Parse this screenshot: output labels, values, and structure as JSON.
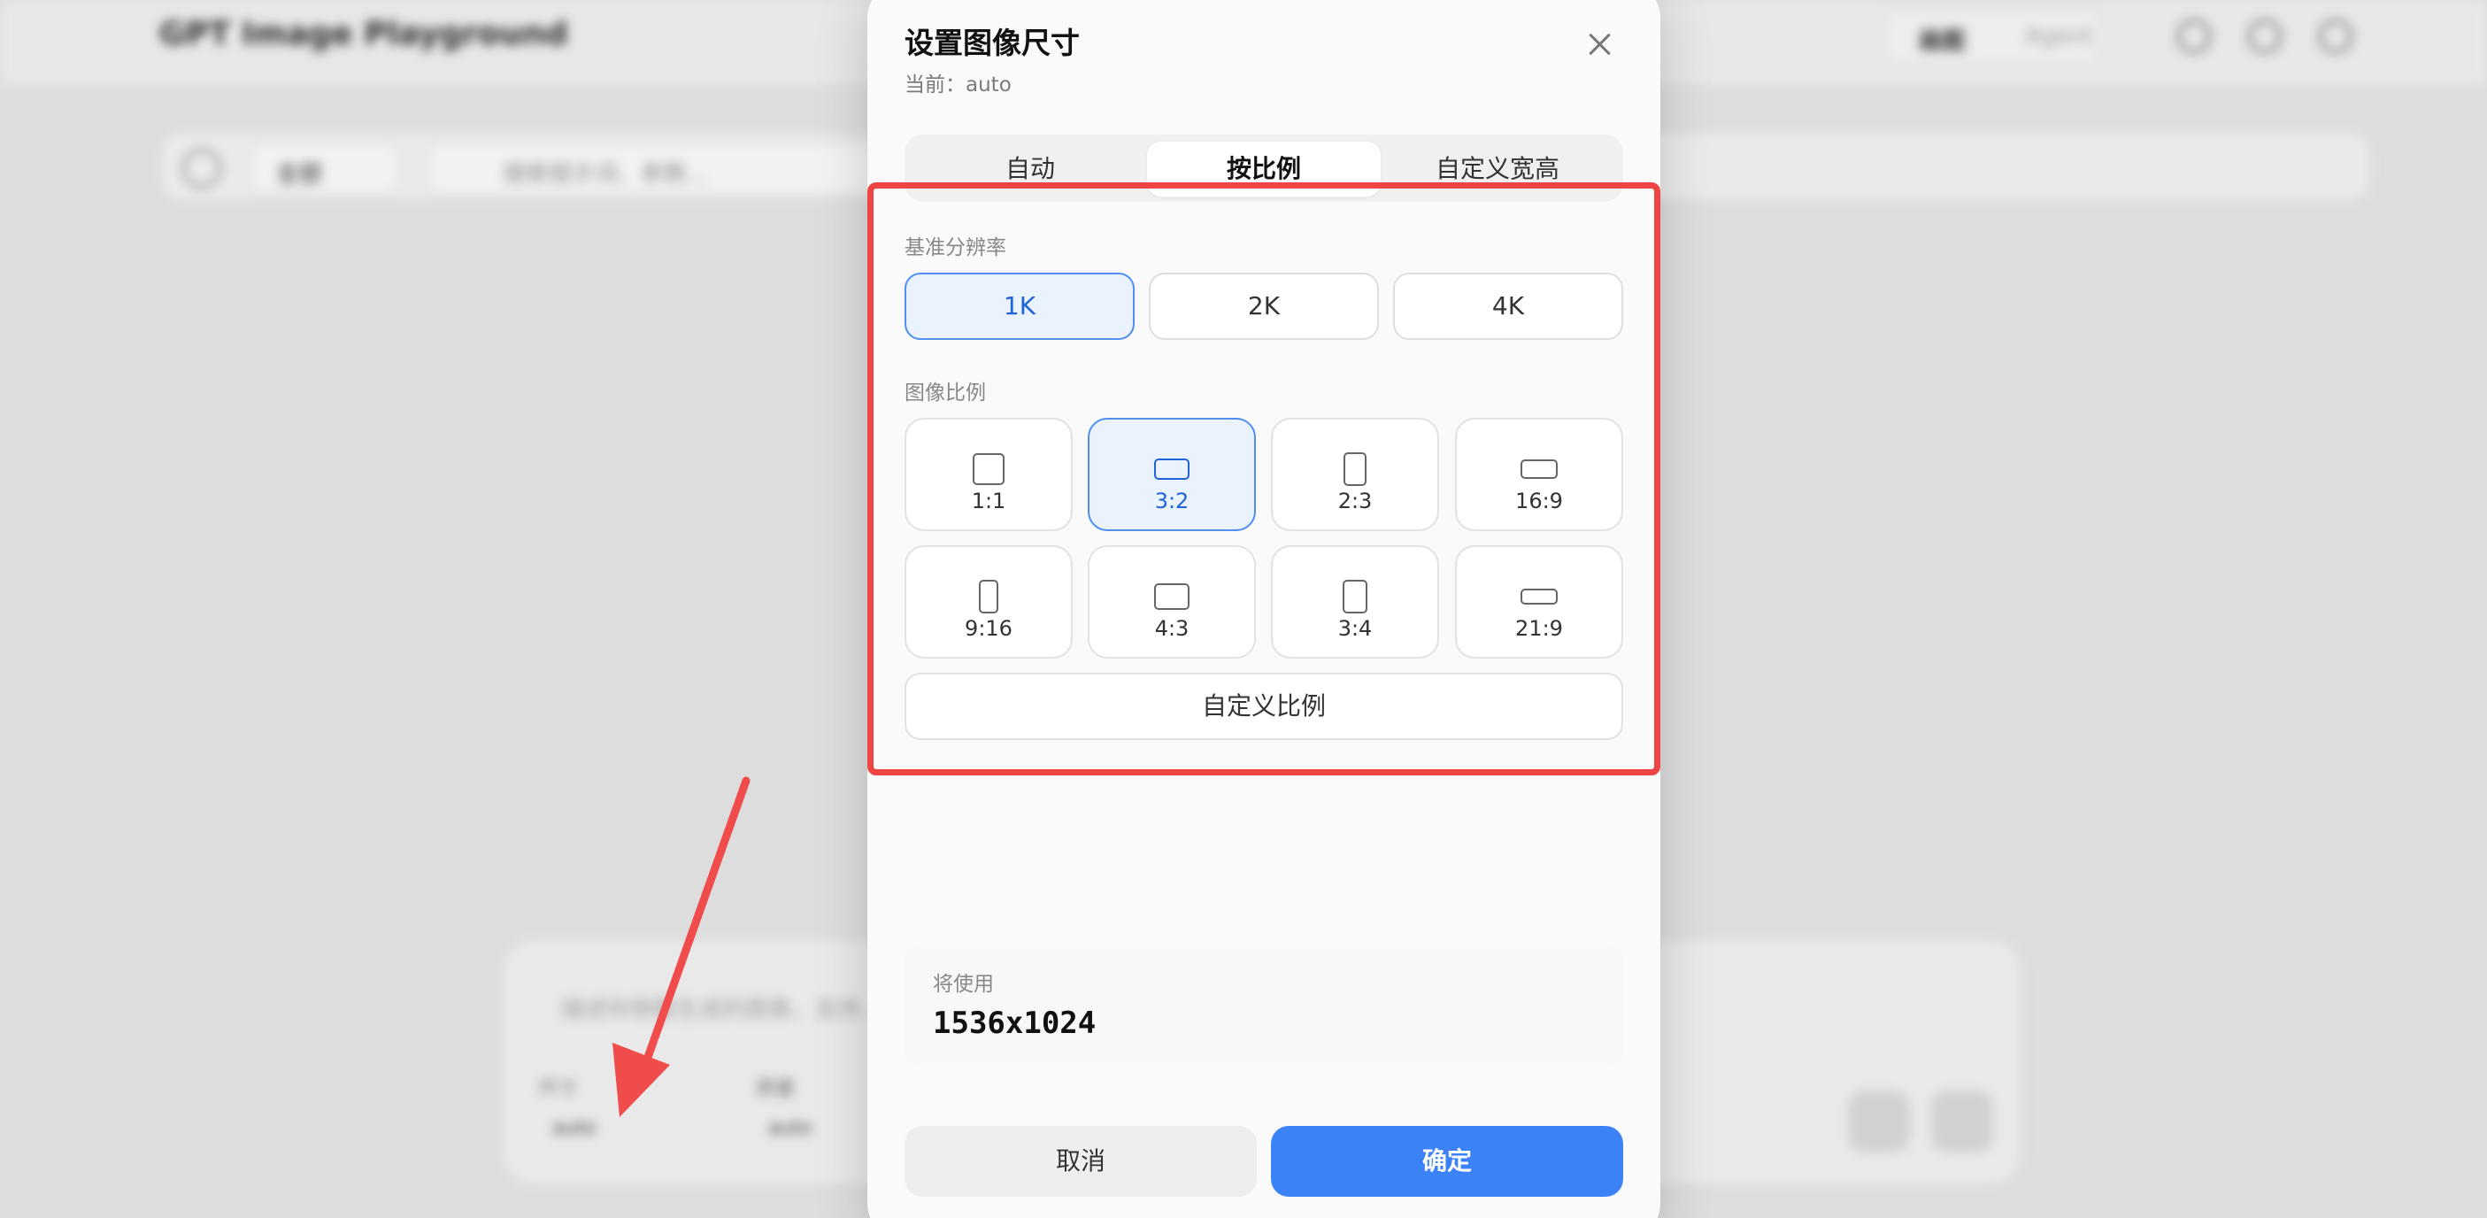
{
  "background_app": {
    "title": "GPT Image Playground",
    "mode_tabs": [
      "画图",
      "Agent"
    ],
    "filter_label": "全部",
    "search_placeholder": "搜索提示词、参数...",
    "composer_hint": "描述你想要生成的图像，支持...",
    "field_labels": [
      "尺寸",
      "质量"
    ],
    "field_values": [
      "auto",
      "auto"
    ]
  },
  "dialog": {
    "title": "设置图像尺寸",
    "current": "当前：auto",
    "tabs": [
      {
        "label": "自动",
        "active": false
      },
      {
        "label": "按比例",
        "active": true
      },
      {
        "label": "自定义宽高",
        "active": false
      }
    ],
    "resolution_label": "基准分辨率",
    "resolutions": [
      {
        "label": "1K",
        "active": true
      },
      {
        "label": "2K",
        "active": false
      },
      {
        "label": "4K",
        "active": false
      }
    ],
    "ratio_label": "图像比例",
    "ratios": [
      {
        "label": "1:1",
        "active": false
      },
      {
        "label": "3:2",
        "active": true
      },
      {
        "label": "2:3",
        "active": false
      },
      {
        "label": "16:9",
        "active": false
      },
      {
        "label": "9:16",
        "active": false
      },
      {
        "label": "4:3",
        "active": false
      },
      {
        "label": "3:4",
        "active": false
      },
      {
        "label": "21:9",
        "active": false
      }
    ],
    "custom_ratio_label": "自定义比例",
    "will_use_label": "将使用",
    "will_use_value": "1536x1024",
    "cancel_label": "取消",
    "confirm_label": "确定"
  },
  "colors": {
    "accent": "#3b82f6",
    "selected_bg": "#eaf2fe",
    "highlight_border": "#ef4444",
    "arrow": "#f14c4c"
  }
}
